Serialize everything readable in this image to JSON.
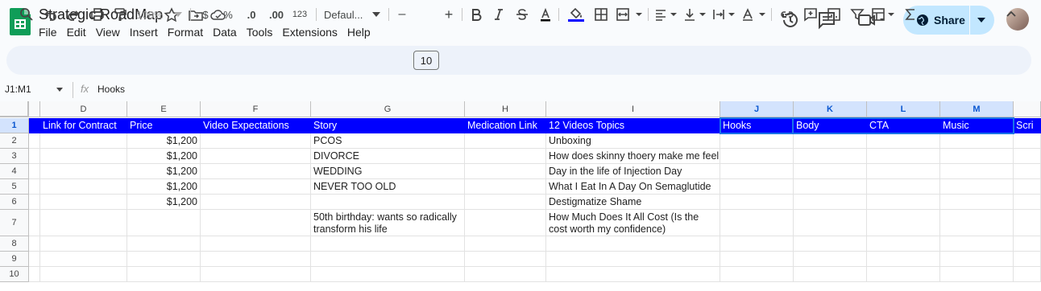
{
  "app": {
    "title": "Strategic RoadMap",
    "menu": [
      "File",
      "Edit",
      "View",
      "Insert",
      "Format",
      "Data",
      "Tools",
      "Extensions",
      "Help"
    ],
    "share_label": "Share"
  },
  "toolbar": {
    "zoom": "100%",
    "currency": "$",
    "percent": "%",
    "dec_decrease": ".0",
    "dec_increase": ".00",
    "number_format": "123",
    "font": "Defaul...",
    "font_size": "10",
    "minus": "–",
    "plus": "+"
  },
  "formula_bar": {
    "range": "J1:M1",
    "fx": "fx",
    "content": "Hooks"
  },
  "columns": [
    "D",
    "E",
    "F",
    "G",
    "H",
    "I",
    "J",
    "K",
    "L",
    "M"
  ],
  "rows": [
    "1",
    "2",
    "3",
    "4",
    "5",
    "6",
    "7",
    "8",
    "9",
    "10"
  ],
  "header_row": {
    "D": "Link for Contract",
    "E": "Price",
    "F": "Video Expectations",
    "G": "Story",
    "H": "Medication Link",
    "I": "12 Videos Topics",
    "J": "Hooks",
    "K": "Body",
    "L": "CTA",
    "M": "Music",
    "N": "Scri"
  },
  "data_rows": [
    {
      "E": "$1,200",
      "G": "PCOS",
      "I": "Unboxing"
    },
    {
      "E": "$1,200",
      "G": "DIVORCE",
      "I": "How does skinny thoery make me feel"
    },
    {
      "E": "$1,200",
      "G": "WEDDING",
      "I": "Day in the life of Injection Day"
    },
    {
      "E": "$1,200",
      "G": "NEVER TOO OLD",
      "I": "What I Eat In A Day On Semaglutide"
    },
    {
      "E": "$1,200",
      "G": "",
      "I": "Destigmatize Shame"
    },
    {
      "E": "",
      "G": "50th birthday: wants so radically transform his life",
      "I": "How Much Does It All Cost (Is the cost worth my confidence)"
    }
  ],
  "colors": {
    "header_fill": "#0000ff",
    "header_text": "#ffffff",
    "selection": "#1a73e8",
    "share_bg": "#c2e7ff"
  },
  "icons": [
    "sheets-logo-icon",
    "star-icon",
    "move-folder-icon",
    "cloud-saved-icon",
    "history-icon",
    "comment-icon",
    "meet-icon",
    "globe-icon",
    "search-icon",
    "undo-icon",
    "redo-icon",
    "print-icon",
    "paint-format-icon"
  ]
}
